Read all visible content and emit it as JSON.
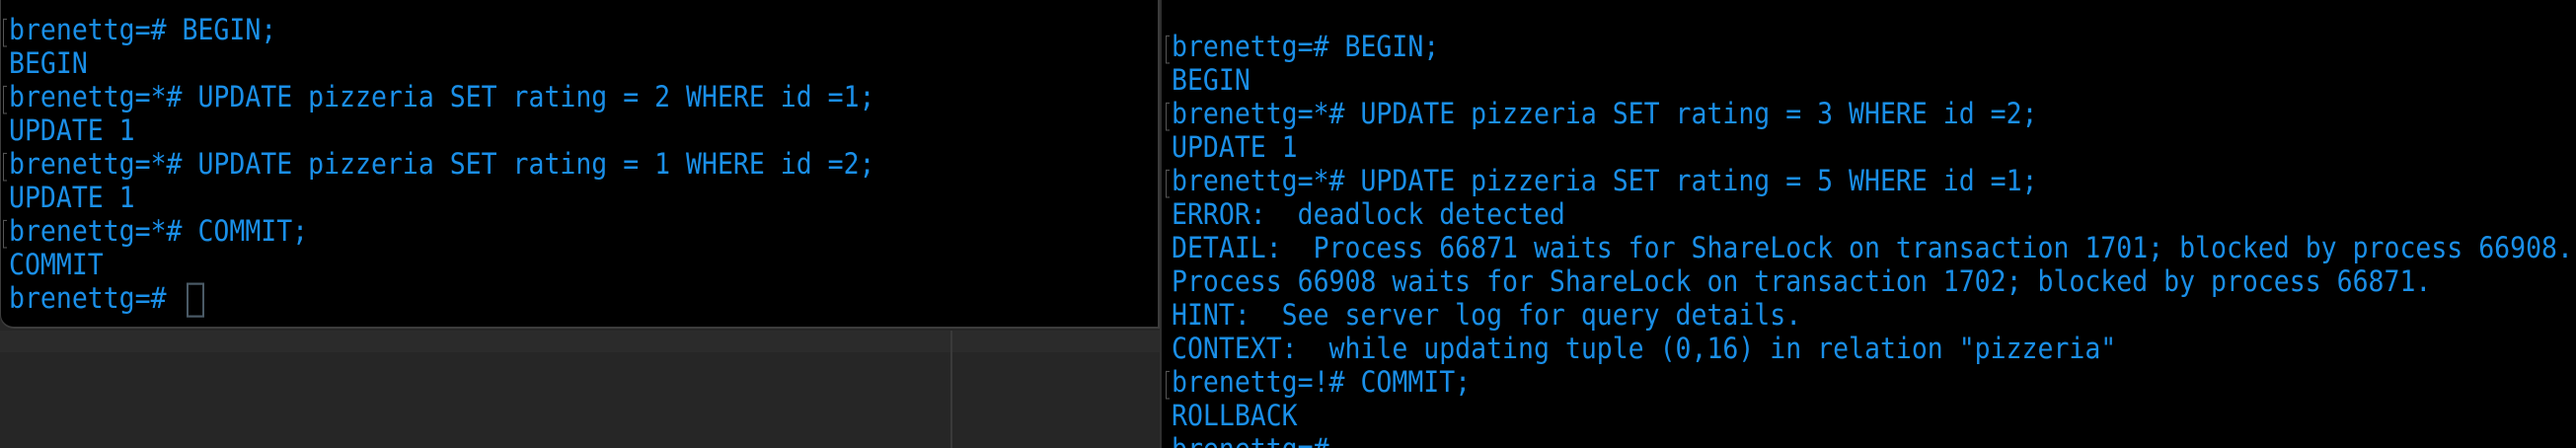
{
  "left_terminal": {
    "lines": [
      {
        "text": "brenettg=# BEGIN;",
        "prompt": true
      },
      {
        "text": "BEGIN",
        "prompt": false
      },
      {
        "text": "brenettg=*# UPDATE pizzeria SET rating = 2 WHERE id =1;",
        "prompt": true
      },
      {
        "text": "UPDATE 1",
        "prompt": false
      },
      {
        "text": "brenettg=*# UPDATE pizzeria SET rating = 1 WHERE id =2;",
        "prompt": true
      },
      {
        "text": "UPDATE 1",
        "prompt": false
      },
      {
        "text": "brenettg=*# COMMIT;",
        "prompt": true
      },
      {
        "text": "COMMIT",
        "prompt": false
      }
    ],
    "current_prompt": "brenettg=# "
  },
  "right_terminal": {
    "lines": [
      {
        "text": "brenettg=# BEGIN;",
        "prompt": true
      },
      {
        "text": "BEGIN",
        "prompt": false
      },
      {
        "text": "brenettg=*# UPDATE pizzeria SET rating = 3 WHERE id =2;",
        "prompt": true
      },
      {
        "text": "UPDATE 1",
        "prompt": false
      },
      {
        "text": "brenettg=*# UPDATE pizzeria SET rating = 5 WHERE id =1;",
        "prompt": true
      },
      {
        "text": "ERROR:  deadlock detected",
        "prompt": false
      },
      {
        "text": "DETAIL:  Process 66871 waits for ShareLock on transaction 1701; blocked by process 66908.",
        "prompt": false
      },
      {
        "text": "Process 66908 waits for ShareLock on transaction 1702; blocked by process 66871.",
        "prompt": false
      },
      {
        "text": "HINT:  See server log for query details.",
        "prompt": false
      },
      {
        "text": "CONTEXT:  while updating tuple (0,16) in relation \"pizzeria\"",
        "prompt": false
      },
      {
        "text": "brenettg=!# COMMIT;",
        "prompt": true
      },
      {
        "text": "ROLLBACK",
        "prompt": false
      },
      {
        "text": "brenettg=# ",
        "prompt": false
      }
    ]
  },
  "colors": {
    "text": "#1a8fe8",
    "background": "#000000",
    "desktop": "#262626"
  }
}
